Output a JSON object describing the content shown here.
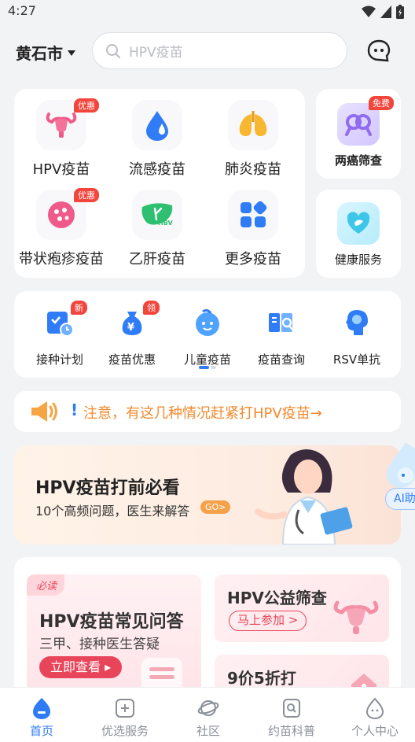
{
  "status_bar": {
    "time": "4:27"
  },
  "header": {
    "city": "黄石市",
    "search_placeholder": "HPV疫苗"
  },
  "vaccines": [
    {
      "label": "HPV疫苗",
      "badge": "优惠",
      "icon": "uterus-icon"
    },
    {
      "label": "流感疫苗",
      "badge": "",
      "icon": "droplet-icon"
    },
    {
      "label": "肺炎疫苗",
      "badge": "",
      "icon": "lungs-icon"
    },
    {
      "label": "带状疱疹疫苗",
      "badge": "优惠",
      "icon": "virus-icon"
    },
    {
      "label": "乙肝疫苗",
      "badge": "",
      "icon": "liver-icon"
    },
    {
      "label": "更多疫苗",
      "badge": "",
      "icon": "grid-icon"
    }
  ],
  "side_cards": [
    {
      "label": "两癌筛查",
      "badge": "免费",
      "icon": "ribbon-icon"
    },
    {
      "label": "健康服务",
      "badge": "",
      "icon": "heart-shield-icon"
    }
  ],
  "services": [
    {
      "label": "接种计划",
      "badge": "新",
      "icon": "calendar-icon"
    },
    {
      "label": "疫苗优惠",
      "badge": "领",
      "icon": "money-bag-icon"
    },
    {
      "label": "儿童疫苗",
      "badge": "",
      "icon": "child-face-icon"
    },
    {
      "label": "疫苗查询",
      "badge": "",
      "icon": "search-book-icon"
    },
    {
      "label": "RSV单抗",
      "badge": "",
      "icon": "head-icon"
    }
  ],
  "notice": {
    "text": "注意，有这几种情况赶紧打HPV疫苗→"
  },
  "banner": {
    "title": "HPV疫苗打前必看",
    "subtitle": "10个高频问题，医生来解答",
    "go": "GO>"
  },
  "ai_float": {
    "label": "AI助"
  },
  "promos": {
    "faq": {
      "tag": "必读",
      "title": "HPV疫苗常见问答",
      "subtitle": "三甲、接种医生答疑",
      "button": "立即查看 ▸"
    },
    "screening": {
      "title": "HPV公益筛查",
      "button": "马上参加 >"
    },
    "discount": {
      "title": "9价5折打"
    }
  },
  "tabbar": [
    {
      "label": "首页",
      "active": true,
      "icon": "home-icon"
    },
    {
      "label": "优选服务",
      "active": false,
      "icon": "plus-square-icon"
    },
    {
      "label": "社区",
      "active": false,
      "icon": "planet-icon"
    },
    {
      "label": "约苗科普",
      "active": false,
      "icon": "science-icon"
    },
    {
      "label": "个人中心",
      "active": false,
      "icon": "user-drop-icon"
    }
  ],
  "colors": {
    "accent": "#2f7cf6",
    "badge": "#f2463d",
    "notice": "#f28a2e",
    "pink": "#e8455a"
  }
}
